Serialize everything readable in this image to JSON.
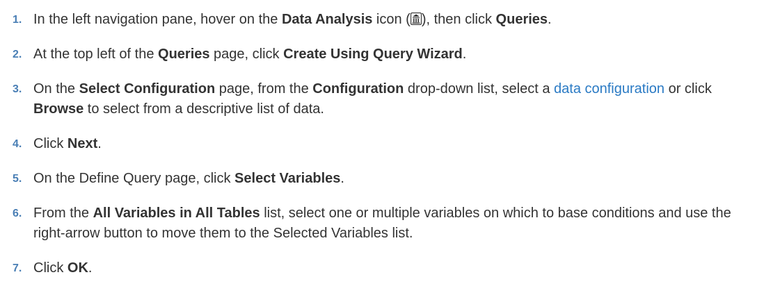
{
  "steps": [
    {
      "number": "1.",
      "parts": [
        "In the left navigation pane, hover on the ",
        "Data Analysis",
        " icon (",
        "), then click ",
        "Queries",
        "."
      ],
      "icon": "data-analysis-icon"
    },
    {
      "number": "2.",
      "parts": [
        "At the top left of the ",
        "Queries",
        " page, click ",
        "Create Using Query Wizard",
        "."
      ]
    },
    {
      "number": "3.",
      "parts": [
        "On the ",
        "Select Configuration",
        " page, from the ",
        "Configuration",
        " drop-down list, select a ",
        "data configuration",
        " or click ",
        "Browse",
        " to select from a descriptive list of data."
      ]
    },
    {
      "number": "4.",
      "parts": [
        "Click ",
        "Next",
        "."
      ]
    },
    {
      "number": "5.",
      "parts": [
        "On the Define Query page, click ",
        "Select Variables",
        "."
      ]
    },
    {
      "number": "6.",
      "parts": [
        "From the ",
        "All Variables in All Tables",
        " list, select one or multiple variables on which to base conditions and use the right-arrow button to move them to the Selected Variables list."
      ]
    },
    {
      "number": "7.",
      "parts": [
        "Click ",
        "OK",
        "."
      ]
    }
  ],
  "colors": {
    "text": "#333333",
    "number": "#4a7fb5",
    "link": "#2a7ac4"
  }
}
